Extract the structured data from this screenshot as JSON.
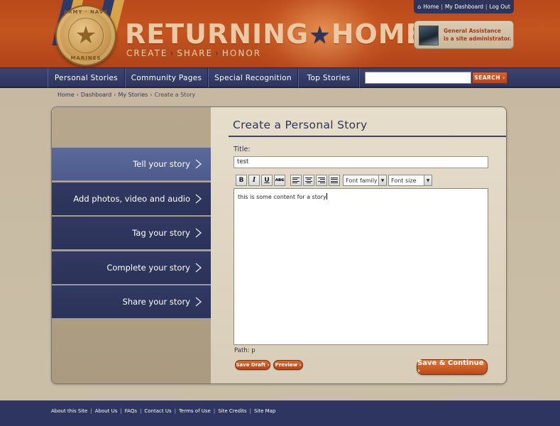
{
  "header": {
    "logo_title_a": "RETURNING",
    "logo_star": "★",
    "logo_title_b": "HOME",
    "tagline": [
      "CREATE",
      "SHARE",
      "HONOR"
    ],
    "medal_text_top": "ARMY · NAVY",
    "medal_text_bottom": "MARINES",
    "top_links": [
      "Home",
      "My Dashboard",
      "Log Out"
    ],
    "user": {
      "name": "General Assistance",
      "role": "is a site administrator."
    },
    "colors": {
      "accent": "#c4551f",
      "nav": "#2e3560"
    }
  },
  "nav": {
    "items": [
      "Personal Stories",
      "Community Pages",
      "Special Recognition",
      "Top Stories"
    ],
    "search_placeholder": "",
    "search_button": "SEARCH ›"
  },
  "breadcrumb": {
    "items": [
      "Home",
      "Dashboard",
      "My Stories"
    ],
    "current": "Create a Story"
  },
  "steps": [
    {
      "label": "Tell your story",
      "active": true
    },
    {
      "label": "Add photos, video and audio",
      "active": false
    },
    {
      "label": "Tag your story",
      "active": false
    },
    {
      "label": "Complete your story",
      "active": false
    },
    {
      "label": "Share your story",
      "active": false
    }
  ],
  "form": {
    "heading": "Create a Personal Story",
    "title_label": "Title:",
    "title_value": "test",
    "toolbar": {
      "bold": "B",
      "italic": "I",
      "underline": "U",
      "strike": "ABC",
      "font_family": "Font family",
      "font_size": "Font size"
    },
    "content": "this is some content for a story",
    "path": "Path: p",
    "save_draft": "Save Draft ›",
    "preview": "Preview ›",
    "save_continue": "Save & Continue ›"
  },
  "footer": {
    "links": [
      "About this Site",
      "About Us",
      "FAQs",
      "Contact Us",
      "Terms of Use",
      "Site Credits",
      "Site Map"
    ]
  }
}
